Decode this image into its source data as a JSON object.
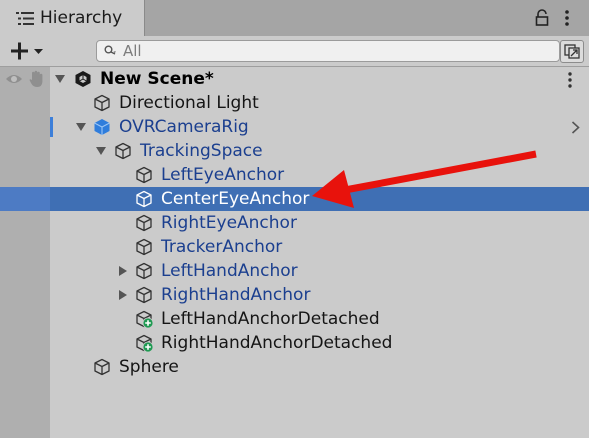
{
  "tab": {
    "title": "Hierarchy"
  },
  "search": {
    "placeholder": "All"
  },
  "tree": [
    {
      "label": "New Scene*"
    },
    {
      "label": "Directional Light"
    },
    {
      "label": "OVRCameraRig"
    },
    {
      "label": "TrackingSpace"
    },
    {
      "label": "LeftEyeAnchor"
    },
    {
      "label": "CenterEyeAnchor"
    },
    {
      "label": "RightEyeAnchor"
    },
    {
      "label": "TrackerAnchor"
    },
    {
      "label": "LeftHandAnchor"
    },
    {
      "label": "RightHandAnchor"
    },
    {
      "label": "LeftHandAnchorDetached"
    },
    {
      "label": "RightHandAnchorDetached"
    },
    {
      "label": "Sphere"
    }
  ],
  "colors": {
    "selection": "#3f6fb4",
    "prefab_text": "#1b3f8f",
    "annotation_arrow": "#e8120c"
  }
}
